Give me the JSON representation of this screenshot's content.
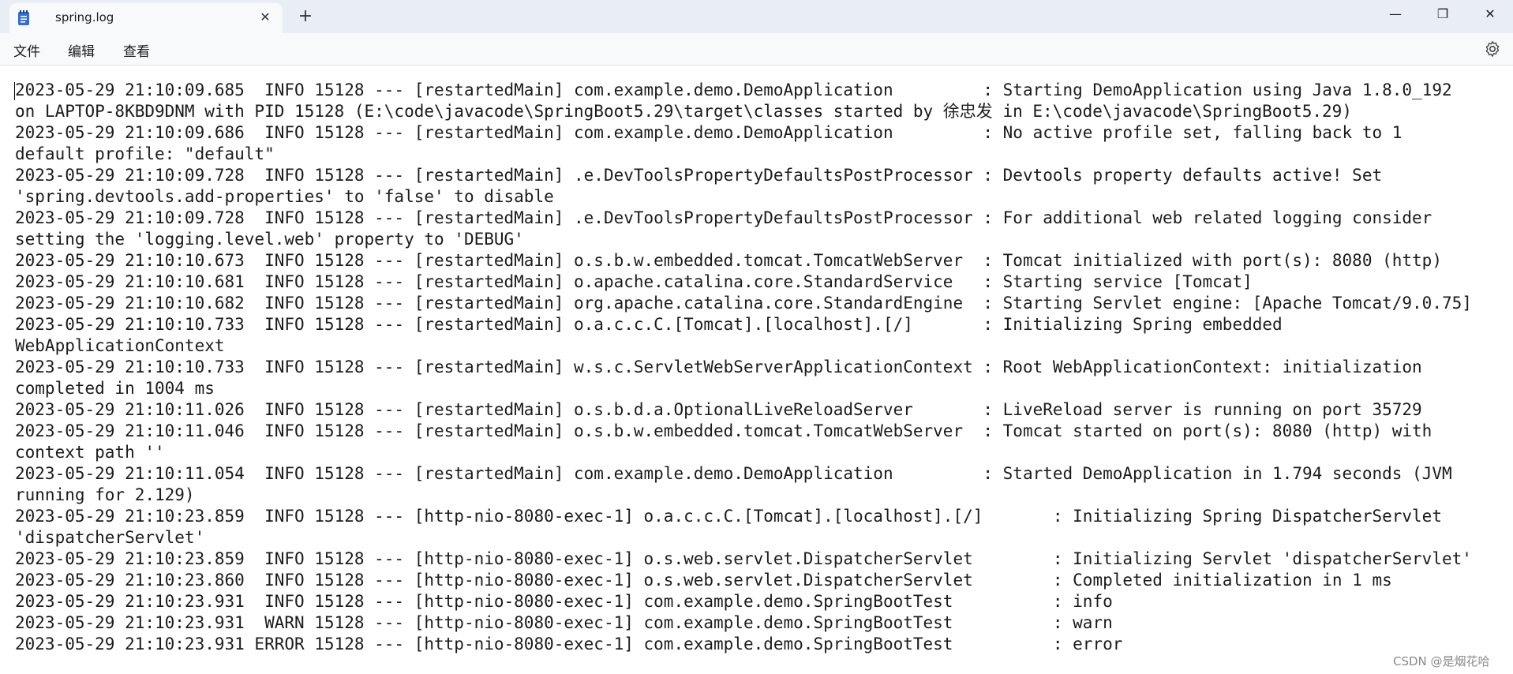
{
  "window": {
    "tab_title": "spring.log",
    "close_tab_glyph": "✕",
    "new_tab_glyph": "+",
    "minimize_glyph": "—",
    "maximize_glyph": "❐",
    "close_glyph": "✕"
  },
  "menu": {
    "file": "文件",
    "edit": "编辑",
    "view": "查看"
  },
  "icons": {
    "notepad": "notepad-icon",
    "settings": "gear-icon"
  },
  "log_lines": [
    "2023-05-29 21:10:09.685  INFO 15128 --- [restartedMain] com.example.demo.DemoApplication         : Starting DemoApplication using Java 1.8.0_192",
    "on LAPTOP-8KBD9DNM with PID 15128 (E:\\code\\javacode\\SpringBoot5.29\\target\\classes started by 徐忠发 in E:\\code\\javacode\\SpringBoot5.29)",
    "2023-05-29 21:10:09.686  INFO 15128 --- [restartedMain] com.example.demo.DemoApplication         : No active profile set, falling back to 1",
    "default profile: \"default\"",
    "2023-05-29 21:10:09.728  INFO 15128 --- [restartedMain] .e.DevToolsPropertyDefaultsPostProcessor : Devtools property defaults active! Set",
    "'spring.devtools.add-properties' to 'false' to disable",
    "2023-05-29 21:10:09.728  INFO 15128 --- [restartedMain] .e.DevToolsPropertyDefaultsPostProcessor : For additional web related logging consider",
    "setting the 'logging.level.web' property to 'DEBUG'",
    "2023-05-29 21:10:10.673  INFO 15128 --- [restartedMain] o.s.b.w.embedded.tomcat.TomcatWebServer  : Tomcat initialized with port(s): 8080 (http)",
    "2023-05-29 21:10:10.681  INFO 15128 --- [restartedMain] o.apache.catalina.core.StandardService   : Starting service [Tomcat]",
    "2023-05-29 21:10:10.682  INFO 15128 --- [restartedMain] org.apache.catalina.core.StandardEngine  : Starting Servlet engine: [Apache Tomcat/9.0.75]",
    "2023-05-29 21:10:10.733  INFO 15128 --- [restartedMain] o.a.c.c.C.[Tomcat].[localhost].[/]       : Initializing Spring embedded",
    "WebApplicationContext",
    "2023-05-29 21:10:10.733  INFO 15128 --- [restartedMain] w.s.c.ServletWebServerApplicationContext : Root WebApplicationContext: initialization",
    "completed in 1004 ms",
    "2023-05-29 21:10:11.026  INFO 15128 --- [restartedMain] o.s.b.d.a.OptionalLiveReloadServer       : LiveReload server is running on port 35729",
    "2023-05-29 21:10:11.046  INFO 15128 --- [restartedMain] o.s.b.w.embedded.tomcat.TomcatWebServer  : Tomcat started on port(s): 8080 (http) with",
    "context path ''",
    "2023-05-29 21:10:11.054  INFO 15128 --- [restartedMain] com.example.demo.DemoApplication         : Started DemoApplication in 1.794 seconds (JVM",
    "running for 2.129)",
    "2023-05-29 21:10:23.859  INFO 15128 --- [http-nio-8080-exec-1] o.a.c.c.C.[Tomcat].[localhost].[/]       : Initializing Spring DispatcherServlet",
    "'dispatcherServlet'",
    "2023-05-29 21:10:23.859  INFO 15128 --- [http-nio-8080-exec-1] o.s.web.servlet.DispatcherServlet        : Initializing Servlet 'dispatcherServlet'",
    "2023-05-29 21:10:23.860  INFO 15128 --- [http-nio-8080-exec-1] o.s.web.servlet.DispatcherServlet        : Completed initialization in 1 ms",
    "2023-05-29 21:10:23.931  INFO 15128 --- [http-nio-8080-exec-1] com.example.demo.SpringBootTest          : info",
    "2023-05-29 21:10:23.931  WARN 15128 --- [http-nio-8080-exec-1] com.example.demo.SpringBootTest          : warn",
    "2023-05-29 21:10:23.931 ERROR 15128 --- [http-nio-8080-exec-1] com.example.demo.SpringBootTest          : error"
  ],
  "watermark": "CSDN @是烟花哈"
}
